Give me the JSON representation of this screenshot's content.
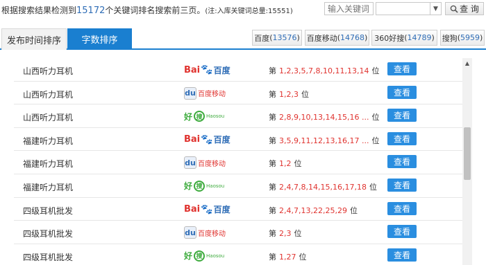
{
  "summary": {
    "prefix": "根据搜索结果检测到",
    "count": "15172",
    "suffix": "个关键词排名搜索前三页。",
    "note": "(注:入库关键词总量:15551)"
  },
  "search": {
    "placeholder": "输入关键词",
    "query_label": "查 询"
  },
  "tabs": [
    {
      "label": "发布时间排序"
    },
    {
      "label": "字数排序"
    }
  ],
  "engines": [
    {
      "name": "百度",
      "count": "13576"
    },
    {
      "name": "百度移动",
      "count": "14768"
    },
    {
      "name": "360好搜",
      "count": "14789"
    },
    {
      "name": "搜狗",
      "count": "5959"
    }
  ],
  "rows": [
    {
      "keyword": "山西听力耳机",
      "engine": "baidu",
      "prefix": "第",
      "ranks": "1,2,3,5,7,8,10,11,13,14",
      "suffix": "位",
      "action": "查看"
    },
    {
      "keyword": "山西听力耳机",
      "engine": "baidu-mobile",
      "prefix": "第",
      "ranks": "1,2,3",
      "suffix": "位",
      "action": "查看"
    },
    {
      "keyword": "山西听力耳机",
      "engine": "haosou",
      "prefix": "第",
      "ranks": "2,8,9,10,13,14,15,16 ...",
      "suffix": "位",
      "action": "查看"
    },
    {
      "keyword": "福建听力耳机",
      "engine": "baidu",
      "prefix": "第",
      "ranks": "3,5,9,11,12,13,16,17 ...",
      "suffix": "位",
      "action": "查看"
    },
    {
      "keyword": "福建听力耳机",
      "engine": "baidu-mobile",
      "prefix": "第",
      "ranks": "1,2",
      "suffix": "位",
      "action": "查看"
    },
    {
      "keyword": "福建听力耳机",
      "engine": "haosou",
      "prefix": "第",
      "ranks": "2,4,7,8,14,15,16,17,18",
      "suffix": "位",
      "action": "查看"
    },
    {
      "keyword": "四级耳机批发",
      "engine": "baidu",
      "prefix": "第",
      "ranks": "2,4,7,13,22,25,29",
      "suffix": "位",
      "action": "查看"
    },
    {
      "keyword": "四级耳机批发",
      "engine": "baidu-mobile",
      "prefix": "第",
      "ranks": "2,3",
      "suffix": "位",
      "action": "查看"
    },
    {
      "keyword": "四级耳机批发",
      "engine": "haosou",
      "prefix": "第",
      "ranks": "1,27",
      "suffix": "位",
      "action": "查看"
    }
  ],
  "logos": {
    "baidu": {
      "part1": "Bai",
      "part2": "百度"
    },
    "baidu_mobile": {
      "box": "du",
      "text": "百度移动"
    },
    "haosou": {
      "hao": "好",
      "sou": "搜",
      "en": "Haosou"
    }
  },
  "icons": {
    "search": "magnifier-icon",
    "dropdown": "chevron-down-icon"
  }
}
